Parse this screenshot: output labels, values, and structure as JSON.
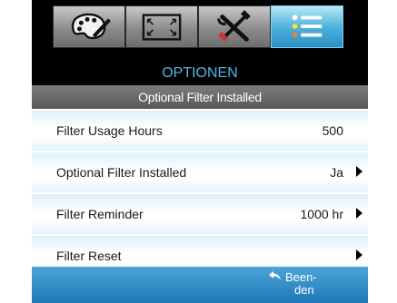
{
  "tabs": [
    {
      "icon": "palette-icon"
    },
    {
      "icon": "screen-resize-icon"
    },
    {
      "icon": "tools-icon"
    },
    {
      "icon": "list-options-icon",
      "active": true
    }
  ],
  "header": {
    "title": "OPTIONEN",
    "subtitle": "Optional Filter Installed"
  },
  "rows": [
    {
      "label": "Filter Usage Hours",
      "value": "500"
    },
    {
      "label": "Optional Filter Installed",
      "value": "Ja"
    },
    {
      "label": "Filter Reminder",
      "value": "1000 hr"
    },
    {
      "label": "Filter Reset",
      "value": ""
    }
  ],
  "footer": {
    "exit_line1": "Been-",
    "exit_line2": "den"
  },
  "colors": {
    "accent": "#4fb7e6",
    "active_tab": "#4fb3dd",
    "footer": "#1f78b8"
  }
}
